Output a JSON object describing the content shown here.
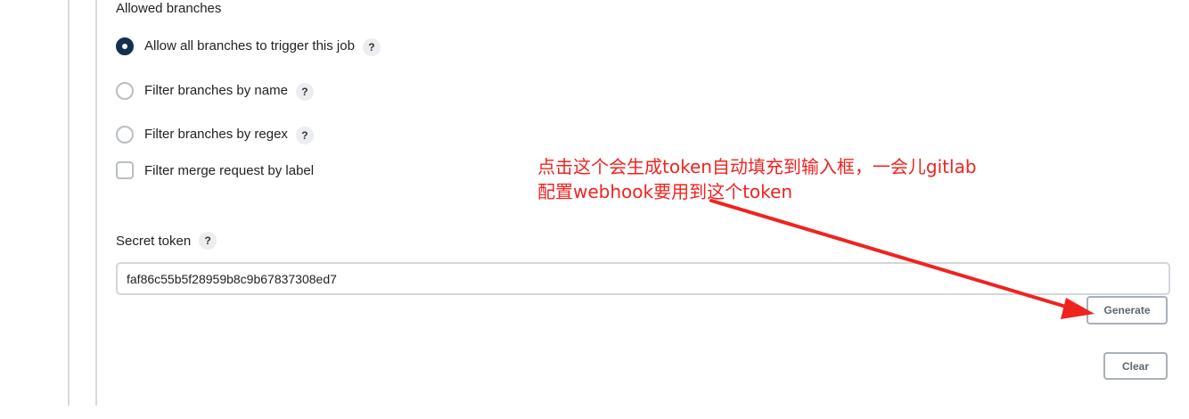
{
  "branches": {
    "label": "Allowed branches",
    "options": [
      {
        "label": "Allow all branches to trigger this job",
        "type": "radio",
        "checked": true
      },
      {
        "label": "Filter branches by name",
        "type": "radio",
        "checked": false
      },
      {
        "label": "Filter branches by regex",
        "type": "radio",
        "checked": false
      },
      {
        "label": "Filter merge request by label",
        "type": "checkbox",
        "checked": false
      }
    ]
  },
  "help_glyph": "?",
  "secret_token": {
    "label": "Secret token",
    "value": "faf86c55b5f28959b8c9b67837308ed7"
  },
  "buttons": {
    "generate": "Generate",
    "clear": "Clear"
  },
  "annotation": {
    "line1": "点击这个会生成token自动填充到输入框，一会儿gitlab",
    "line2": "配置webhook要用到这个token",
    "color": "#f0231f"
  },
  "colors": {
    "radio_checked": "#15304c",
    "border": "#d3d7dc"
  }
}
